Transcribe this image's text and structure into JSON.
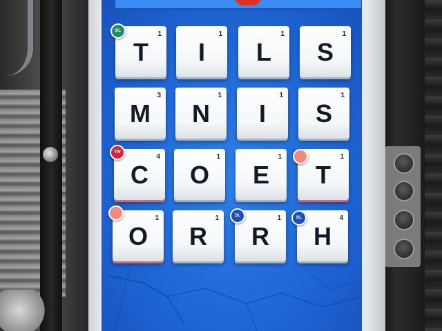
{
  "board": {
    "tiles": [
      {
        "letter": "T",
        "points": "1"
      },
      {
        "letter": "I",
        "points": "1"
      },
      {
        "letter": "L",
        "points": "1"
      },
      {
        "letter": "S",
        "points": "1"
      },
      {
        "letter": "M",
        "points": "3"
      },
      {
        "letter": "N",
        "points": "1"
      },
      {
        "letter": "I",
        "points": "1"
      },
      {
        "letter": "S",
        "points": "1"
      },
      {
        "letter": "C",
        "points": "4"
      },
      {
        "letter": "O",
        "points": "1"
      },
      {
        "letter": "E",
        "points": "1"
      },
      {
        "letter": "T",
        "points": "1"
      },
      {
        "letter": "O",
        "points": "1"
      },
      {
        "letter": "R",
        "points": "1"
      },
      {
        "letter": "R",
        "points": "1"
      },
      {
        "letter": "H",
        "points": "4"
      }
    ],
    "badges": [
      {
        "label": "DL",
        "color": "#1f8f6a",
        "icon": "double-letter-icon"
      },
      {
        "label": "TW",
        "color": "#d0263a",
        "icon": "triple-word-icon"
      },
      {
        "label": "",
        "color": "#f08a7a",
        "icon": "bonus-icon"
      },
      {
        "label": "",
        "color": "#f08a7a",
        "icon": "bonus-icon"
      },
      {
        "label": "DL",
        "color": "#1c4fb8",
        "icon": "double-letter-icon"
      },
      {
        "label": "DL",
        "color": "#1c4fb8",
        "icon": "double-letter-icon"
      }
    ]
  },
  "colors": {
    "screen": "#1f66d6",
    "tile": "#f4f6f8",
    "letter": "#121a26"
  }
}
